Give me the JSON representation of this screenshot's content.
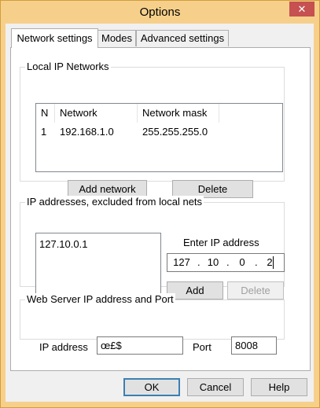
{
  "window": {
    "title": "Options",
    "close_glyph": "✕"
  },
  "tabs": [
    {
      "label": "Network settings",
      "active": true
    },
    {
      "label": "Modes",
      "active": false
    },
    {
      "label": "Advanced settings",
      "active": false
    }
  ],
  "icons": {
    "toolbar_icon": "edit-tools-icon"
  },
  "local_networks": {
    "group_label": "Local IP Networks",
    "columns": [
      "N",
      "Network",
      "Network mask"
    ],
    "rows": [
      {
        "n": "1",
        "network": "192.168.1.0",
        "mask": "255.255.255.0"
      }
    ],
    "add_label": "Add network",
    "delete_label": "Delete"
  },
  "excluded": {
    "group_label": "IP addresses, excluded from local nets",
    "items": [
      "127.10.0.1"
    ],
    "enter_label": "Enter IP address",
    "ip_octets": [
      "127",
      "10",
      "0",
      "2"
    ],
    "add_label": "Add",
    "delete_label": "Delete"
  },
  "web_server": {
    "group_label": "Web Server IP address and Port",
    "ip_label": "IP address",
    "ip_value": "œ£$",
    "port_label": "Port",
    "port_value": "8008"
  },
  "footer": {
    "ok_label": "OK",
    "cancel_label": "Cancel",
    "help_label": "Help"
  },
  "colors": {
    "frame": "#f6d08b",
    "close": "#c75050",
    "button": "#e1e1e1",
    "accent_border": "#3c7fb1"
  }
}
